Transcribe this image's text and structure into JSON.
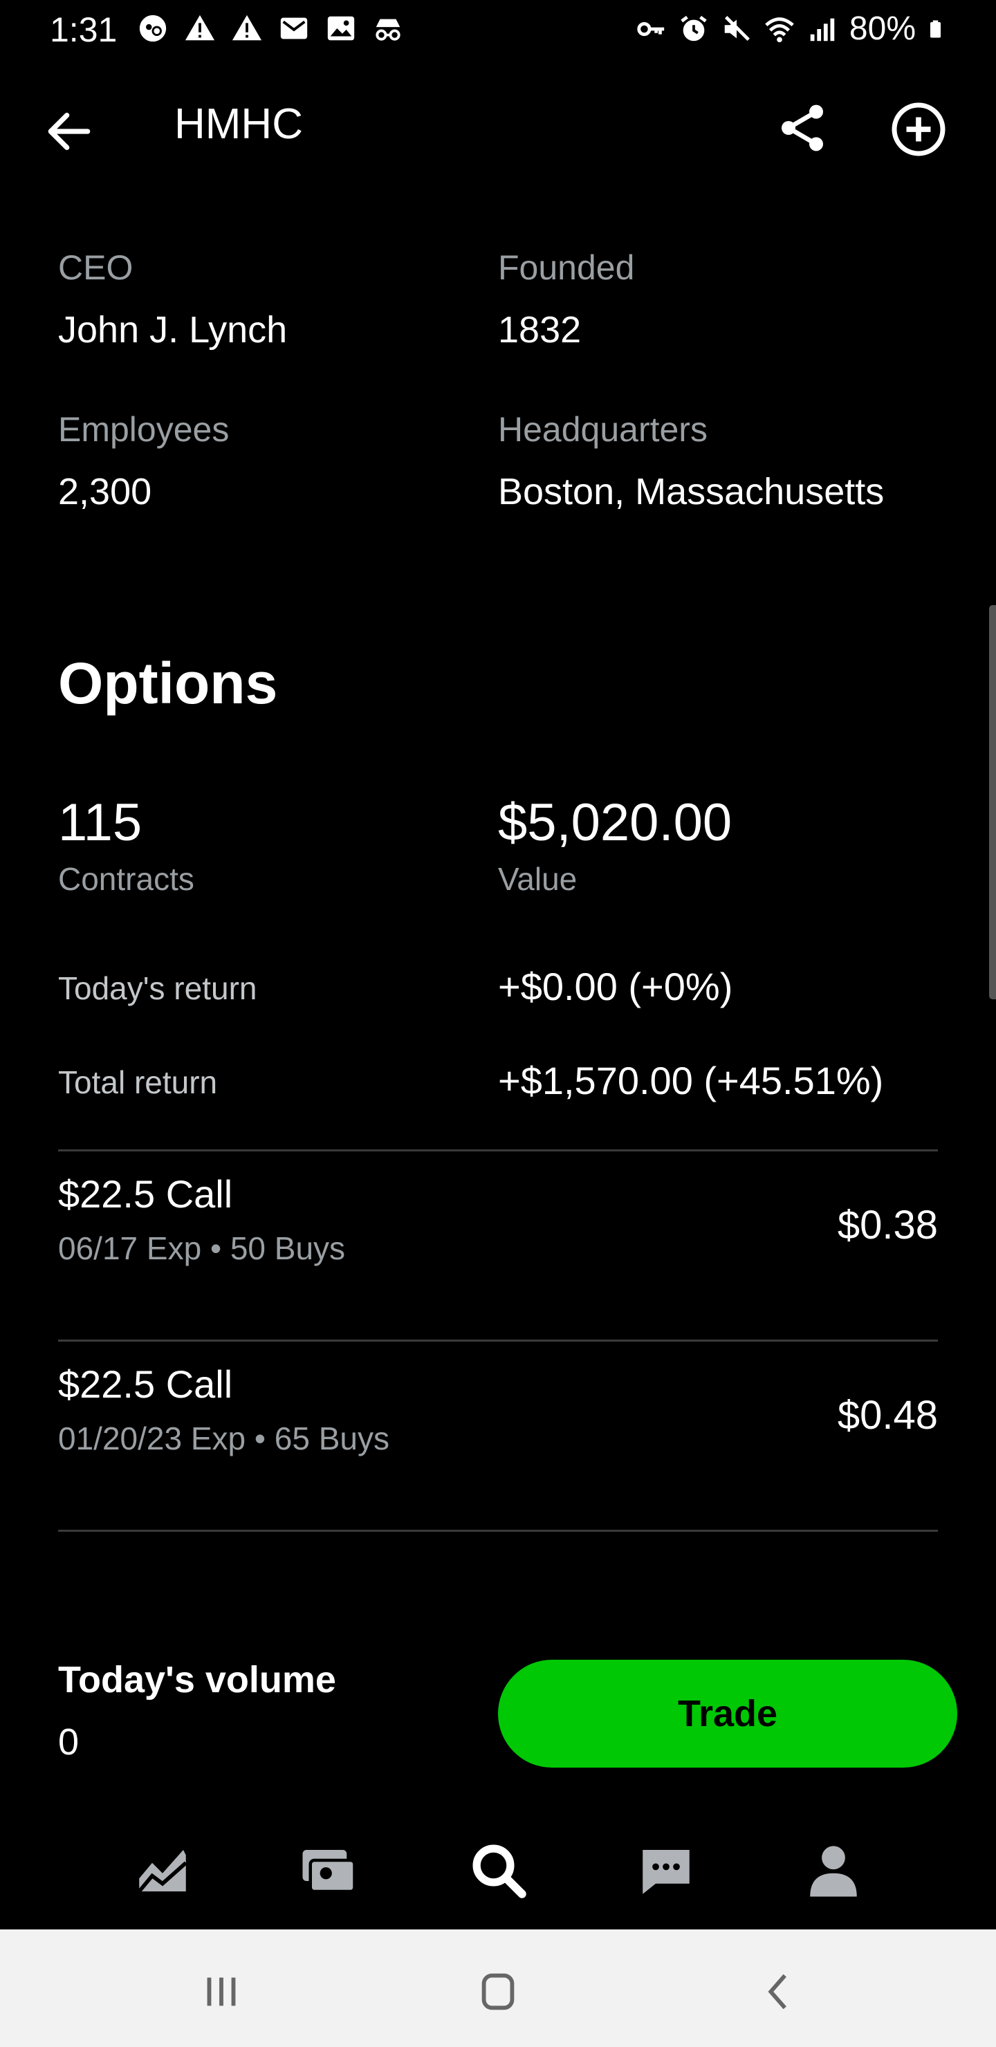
{
  "status_bar": {
    "time": "1:31",
    "battery": "80%",
    "left_icons": [
      "incognito-face-icon",
      "warning-icon",
      "warning-icon",
      "gmail-icon",
      "image-icon",
      "incognito-icon"
    ],
    "right_icons": [
      "vpn-key-icon",
      "alarm-icon",
      "mute-icon",
      "wifi-icon",
      "signal-icon",
      "battery-icon"
    ]
  },
  "header": {
    "ticker": "HMHC"
  },
  "about": {
    "ceo_label": "CEO",
    "ceo_value": "John J. Lynch",
    "founded_label": "Founded",
    "founded_value": "1832",
    "employees_label": "Employees",
    "employees_value": "2,300",
    "hq_label": "Headquarters",
    "hq_value": "Boston, Massachusetts"
  },
  "options": {
    "title": "Options",
    "contracts_value": "115",
    "contracts_label": "Contracts",
    "value_value": "$5,020.00",
    "value_label": "Value",
    "todays_return_label": "Today's return",
    "todays_return_value": "+$0.00 (+0%)",
    "total_return_label": "Total return",
    "total_return_value": "+$1,570.00 (+45.51%)",
    "positions": [
      {
        "title": "$22.5 Call",
        "subtitle": "06/17 Exp • 50 Buys",
        "price": "$0.38"
      },
      {
        "title": "$22.5 Call",
        "subtitle": "01/20/23 Exp • 65 Buys",
        "price": "$0.48"
      }
    ]
  },
  "footer": {
    "volume_label": "Today's volume",
    "volume_value": "0",
    "trade_label": "Trade"
  },
  "colors": {
    "background": "#000000",
    "accent_green": "#00c805",
    "muted_text": "#9a9fa3",
    "divider": "#3a3a3a",
    "system_nav_bg": "#f2f2f2"
  },
  "bottom_nav": [
    "chart-icon",
    "wallet-card-icon",
    "search-icon",
    "messages-icon",
    "account-icon"
  ]
}
